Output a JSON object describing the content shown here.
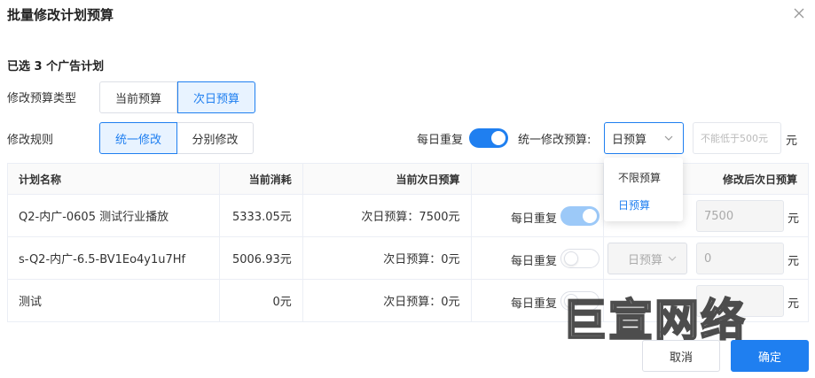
{
  "dialog": {
    "title": "批量修改计划预算",
    "selected_count_text": "已选 3 个广告计划"
  },
  "budget_type": {
    "label": "修改预算类型",
    "options": [
      "当前预算",
      "次日预算"
    ],
    "selected": "次日预算"
  },
  "rule": {
    "label": "修改规则",
    "options": [
      "统一修改",
      "分别修改"
    ],
    "selected": "统一修改",
    "daily_repeat_label": "每日重复",
    "daily_repeat_on": true,
    "unified_budget_label": "统一修改预算:",
    "budget_select_value": "日预算",
    "budget_input_placeholder": "不能低于500元",
    "unit": "元",
    "dropdown_options": [
      "不限预算",
      "日预算"
    ],
    "dropdown_selected": "日预算"
  },
  "table": {
    "headers": [
      "计划名称",
      "当前消耗",
      "当前次日预算",
      "",
      "修改后次日预算"
    ],
    "rows": [
      {
        "name": "Q2-内广-0605 测试行业播放",
        "spend": "5333.05元",
        "next_budget": "次日预算：7500元",
        "repeat_label": "每日重复",
        "repeat_on": true,
        "select": "",
        "value": "7500",
        "unit": "元"
      },
      {
        "name": "s-Q2-内广-6.5-BV1Eo4y1u7Hf",
        "spend": "5006.93元",
        "next_budget": "次日预算：0元",
        "repeat_label": "每日重复",
        "repeat_on": false,
        "select": "日预算",
        "value": "0",
        "unit": "元"
      },
      {
        "name": "测试",
        "spend": "0元",
        "next_budget": "次日预算：0元",
        "repeat_label": "每日重复",
        "repeat_on": false,
        "select": "",
        "value": "",
        "unit": "元"
      }
    ]
  },
  "footer": {
    "cancel": "取消",
    "ok": "确定"
  },
  "watermark": "巨宣网络",
  "colors": {
    "accent": "#1f7ff0",
    "accent_light": "#e8f3ff",
    "border": "#dcdfe6"
  }
}
